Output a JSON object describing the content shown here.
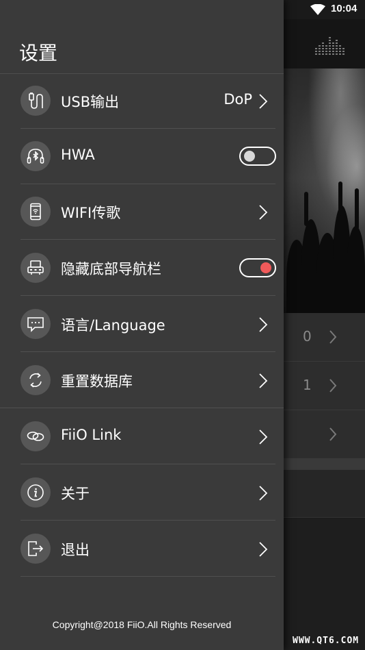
{
  "status_bar": {
    "time": "10:04",
    "wifi_icon": "wifi-icon"
  },
  "drawer": {
    "title": "设置",
    "items": [
      {
        "label": "USB输出",
        "value": "DoP",
        "icon": "usb-plug-icon",
        "control": "chevron"
      },
      {
        "label": "HWA",
        "icon": "bluetooth-headphones-icon",
        "control": "toggle",
        "toggle_on": false
      },
      {
        "label": "WIFI传歌",
        "icon": "phone-wifi-icon",
        "control": "chevron"
      },
      {
        "label": "隐藏底部导航栏",
        "icon": "navigation-bar-icon",
        "control": "toggle",
        "toggle_on": true
      },
      {
        "label": "语言/Language",
        "icon": "chat-bubble-icon",
        "control": "chevron"
      },
      {
        "label": "重置数据库",
        "icon": "refresh-icon",
        "control": "chevron"
      },
      {
        "label": "FiiO Link",
        "icon": "link-icon",
        "control": "chevron"
      },
      {
        "label": "关于",
        "icon": "info-icon",
        "control": "chevron"
      },
      {
        "label": "退出",
        "icon": "exit-icon",
        "control": "chevron"
      }
    ],
    "copyright": "Copyright@2018 FiiO.All Rights Reserved"
  },
  "background": {
    "list_values": [
      "0",
      "1",
      ""
    ]
  },
  "watermark": "WWW.QT6.COM",
  "colors": {
    "drawer_bg": "#3a3a3a",
    "icon_circle": "#575757",
    "toggle_on_knob": "#f05a5a",
    "toggle_off_knob": "#d8d8d8"
  }
}
